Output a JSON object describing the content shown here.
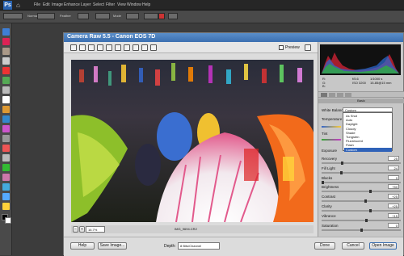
{
  "menubar": {
    "logo": "Ps",
    "items": [
      "File",
      "Edit",
      "Image",
      "Enhance",
      "Layer",
      "Select",
      "Filter",
      "View",
      "Window",
      "Help"
    ]
  },
  "optionsbar": {
    "normal": "Normal",
    "feather": "Feather",
    "mode": "Mode"
  },
  "dialog": {
    "title": "Camera Raw 5.5  -  Canon EOS 7D",
    "preview_label": "Preview",
    "filename": "IMG_9694.CR2",
    "zoom": "16.7%",
    "depth_label": "Depth:",
    "depth_value": "8 Bits/Channel",
    "buttons": {
      "help": "Help",
      "save": "Save Image...",
      "done": "Done",
      "cancel": "Cancel",
      "open": "Open Image"
    }
  },
  "readout": {
    "r": "R:",
    "g": "G:",
    "b": "B:",
    "aperture": "f/5.6",
    "shutter": "1/1000 s",
    "iso": "ISO 3200",
    "lens": "15-85@15 mm"
  },
  "panel": {
    "section": "Basic",
    "wb_label": "White Balance:",
    "wb_value": "Custom",
    "wb_options": [
      "As Shot",
      "Auto",
      "Daylight",
      "Cloudy",
      "Shade",
      "Tungsten",
      "Fluorescent",
      "Flash",
      "Custom"
    ],
    "wb_selected": "Custom",
    "temperature": "Temperature",
    "tint": "Tint",
    "exposure": "Exposure",
    "sliders": [
      {
        "label": "Recovery",
        "value": "25",
        "pos": 0.25
      },
      {
        "label": "Fill Light",
        "value": "24",
        "pos": 0.24
      },
      {
        "label": "Blacks",
        "value": "0",
        "pos": 0.0
      },
      {
        "label": "Brightness",
        "value": "+50",
        "pos": 0.62
      },
      {
        "label": "Contrast",
        "value": "+25",
        "pos": 0.56
      },
      {
        "label": "Clarity",
        "value": "+25",
        "pos": 0.62
      },
      {
        "label": "Vibrance",
        "value": "+15",
        "pos": 0.57
      },
      {
        "label": "Saturation",
        "value": "0",
        "pos": 0.5
      }
    ]
  },
  "colors": {
    "title": "#3b6fb0",
    "accent": "#2f62b8"
  }
}
